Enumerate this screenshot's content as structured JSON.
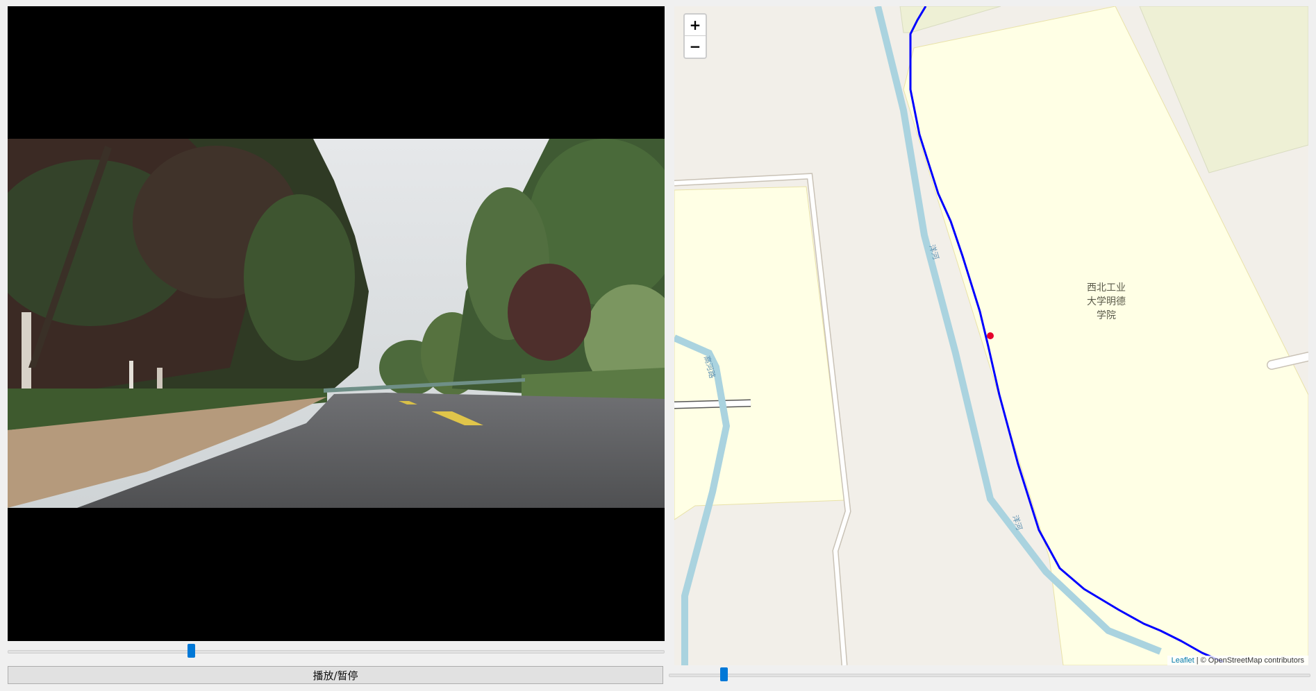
{
  "video": {
    "progress_fraction": 0.277
  },
  "controls": {
    "play_pause_label": "播放/暂停",
    "map_slider_fraction": 0.08
  },
  "map": {
    "zoom_in_label": "+",
    "zoom_out_label": "−",
    "place_name_lines": [
      "西北工业",
      "大学明德",
      "学院"
    ],
    "river_label_1": "洋河",
    "river_label_2": "洋河",
    "river_label_3": "高河路",
    "attribution_leaflet": "Leaflet",
    "attribution_rest": "| © OpenStreetMap contributors",
    "colors": {
      "route": "#0000ff",
      "position_marker": "#e5002b",
      "river": "#aad3df",
      "campus": "#ffffe5",
      "background": "#f2efe9"
    }
  }
}
